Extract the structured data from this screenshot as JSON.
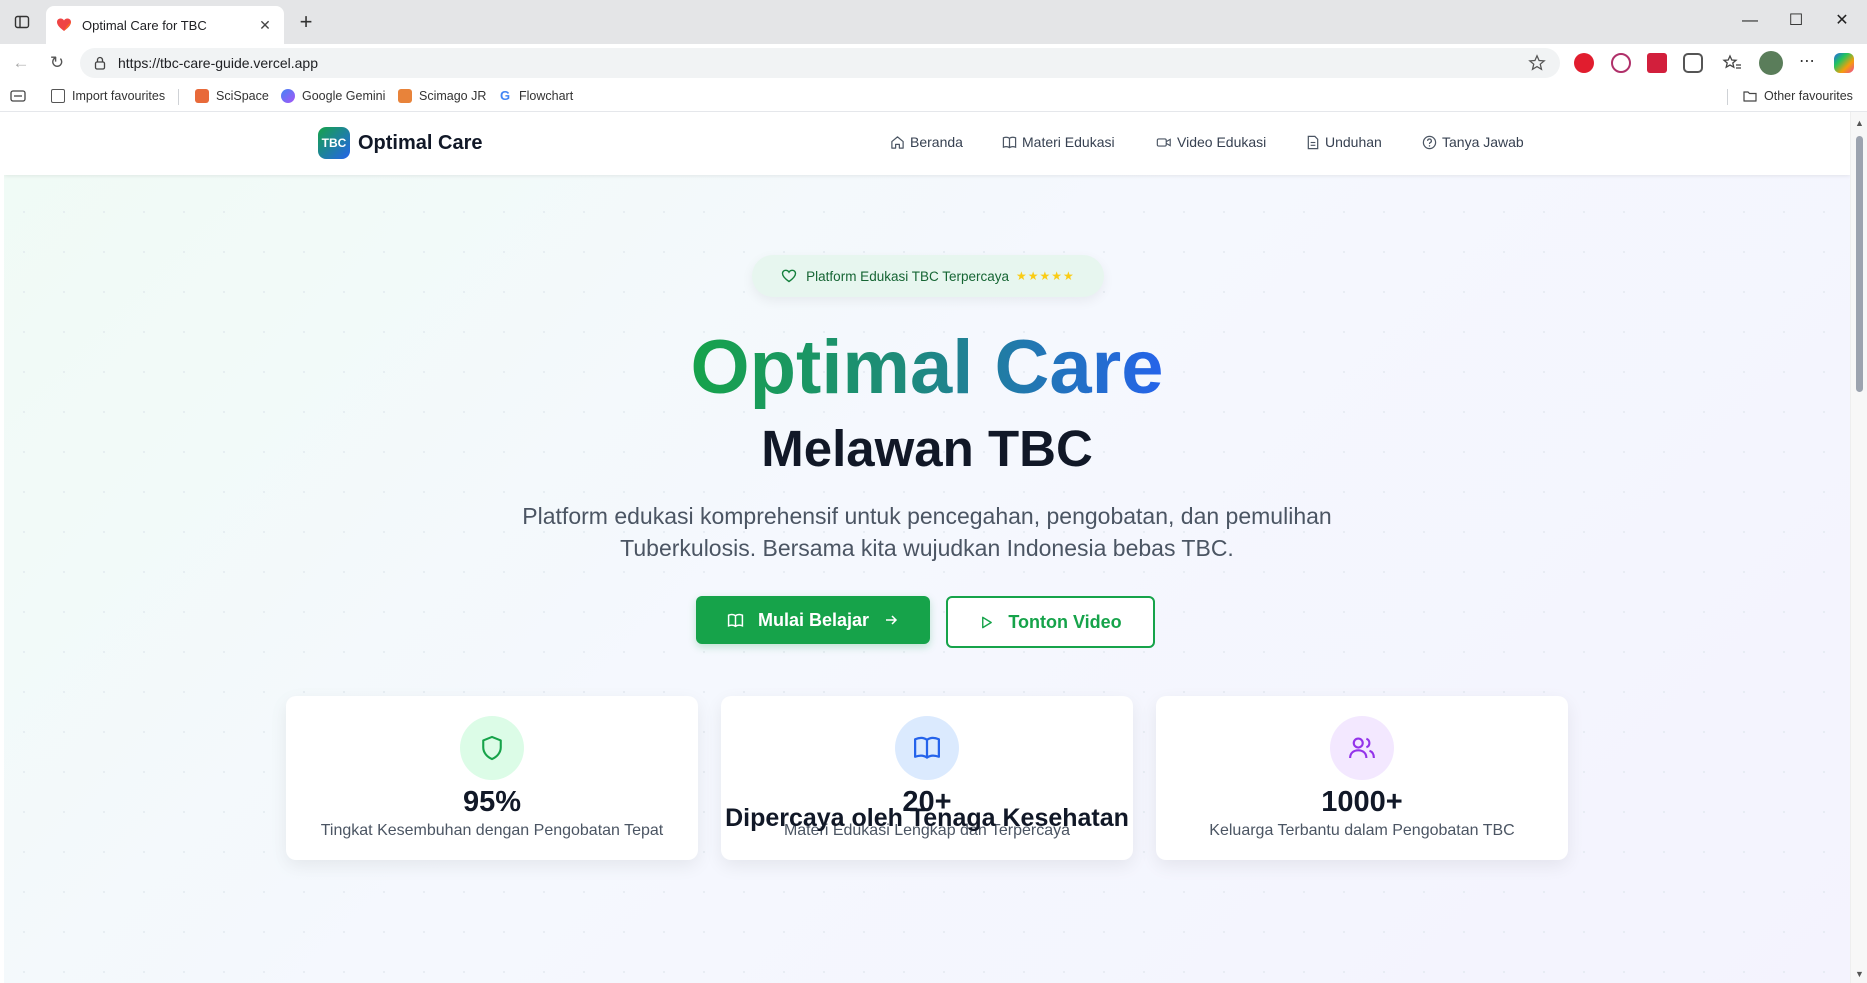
{
  "browser": {
    "tab_title": "Optimal Care for TBC",
    "url": "https://tbc-care-guide.vercel.app",
    "bookmarks": [
      "Import favourites",
      "SciSpace",
      "Google Gemini",
      "Scimago JR",
      "Flowchart"
    ],
    "other_favourites": "Other favourites"
  },
  "site": {
    "logo_badge": "TBC",
    "logo_text": "Optimal Care",
    "nav": [
      "Beranda",
      "Materi Edukasi",
      "Video Edukasi",
      "Unduhan",
      "Tanya Jawab"
    ]
  },
  "hero": {
    "pill_text": "Platform Edukasi TBC Terpercaya",
    "pill_stars": "★★★★★",
    "title": "Optimal Care",
    "subtitle": "Melawan TBC",
    "description": "Platform edukasi komprehensif untuk pencegahan, pengobatan, dan pemulihan Tuberkulosis. Bersama kita wujudkan Indonesia bebas TBC.",
    "primary_button": "Mulai Belajar",
    "secondary_button": "Tonton Video"
  },
  "stats": [
    {
      "value": "95%",
      "label": "Tingkat Kesembuhan dengan Pengobatan Tepat",
      "icon": "shield-icon",
      "color": "#16a34a",
      "bg": "#dcfce7"
    },
    {
      "value": "20+",
      "label": "Materi Edukasi Lengkap dan Terpercaya",
      "icon": "book-open-icon",
      "color": "#2563eb",
      "bg": "#dbeafe"
    },
    {
      "value": "1000+",
      "label": "Keluarga Terbantu dalam Pengobatan TBC",
      "icon": "users-icon",
      "color": "#9333ea",
      "bg": "#f3e8ff"
    }
  ],
  "section_title": "Dipercaya oleh Tenaga Kesehatan",
  "colors": {
    "accent_green": "#16a34a",
    "accent_blue": "#2563eb"
  }
}
